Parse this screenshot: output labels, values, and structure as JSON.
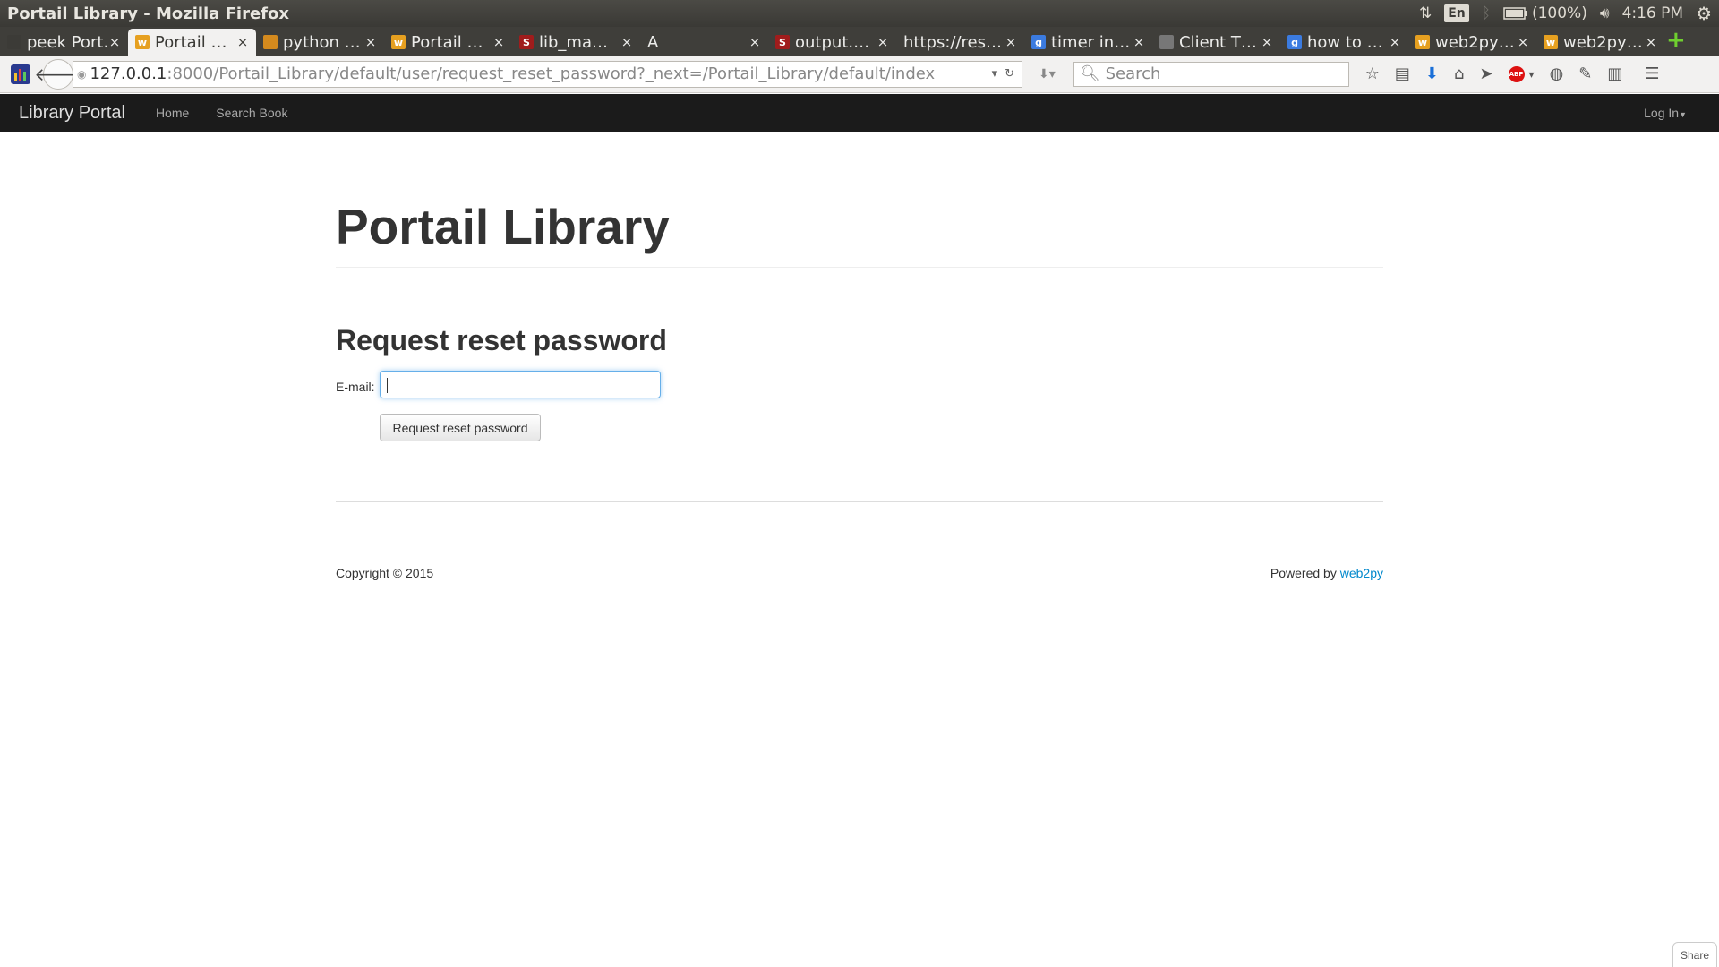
{
  "window": {
    "title": "Portail Library - Mozilla Firefox"
  },
  "tray": {
    "lang": "En",
    "battery": "(100%)",
    "time": "4:16 PM"
  },
  "tabs": [
    {
      "label": "peek Port…",
      "fav_color": "#3c3b37",
      "fav_text": ""
    },
    {
      "label": "Portail …",
      "fav_color": "#e6a020",
      "fav_text": "w",
      "active": true
    },
    {
      "label": "python …",
      "fav_color": "#d48a1e",
      "fav_text": ""
    },
    {
      "label": "Portail …",
      "fav_color": "#e6a020",
      "fav_text": "w"
    },
    {
      "label": "lib_ma…",
      "fav_color": "#a01c1c",
      "fav_text": "S"
    },
    {
      "label": "A",
      "fav_color": "",
      "fav_text": ""
    },
    {
      "label": "output.…",
      "fav_color": "#a01c1c",
      "fav_text": "S"
    },
    {
      "label": "https://res…",
      "fav_color": "",
      "fav_text": ""
    },
    {
      "label": "timer in…",
      "fav_color": "#3b7be0",
      "fav_text": "g"
    },
    {
      "label": "Client T…",
      "fav_color": "#777",
      "fav_text": ""
    },
    {
      "label": "how to …",
      "fav_color": "#3b7be0",
      "fav_text": "g"
    },
    {
      "label": "web2py…",
      "fav_color": "#e6a020",
      "fav_text": "w"
    },
    {
      "label": "web2py…",
      "fav_color": "#e6a020",
      "fav_text": "w"
    }
  ],
  "url": {
    "host": "127.0.0.1",
    "rest": ":8000/Portail_Library/default/user/request_reset_password?_next=/Portail_Library/default/index"
  },
  "search": {
    "placeholder": "Search"
  },
  "app_nav": {
    "brand": "Library Portal",
    "home": "Home",
    "search_book": "Search Book",
    "login": "Log In"
  },
  "page": {
    "title": "Portail Library",
    "form_title": "Request reset password",
    "email_label": "E-mail:",
    "email_value": "",
    "submit_label": "Request reset password"
  },
  "footer": {
    "copyright": "Copyright © 2015",
    "powered_by": "Powered by",
    "powered_link": "web2py"
  },
  "share": {
    "label": "Share"
  }
}
